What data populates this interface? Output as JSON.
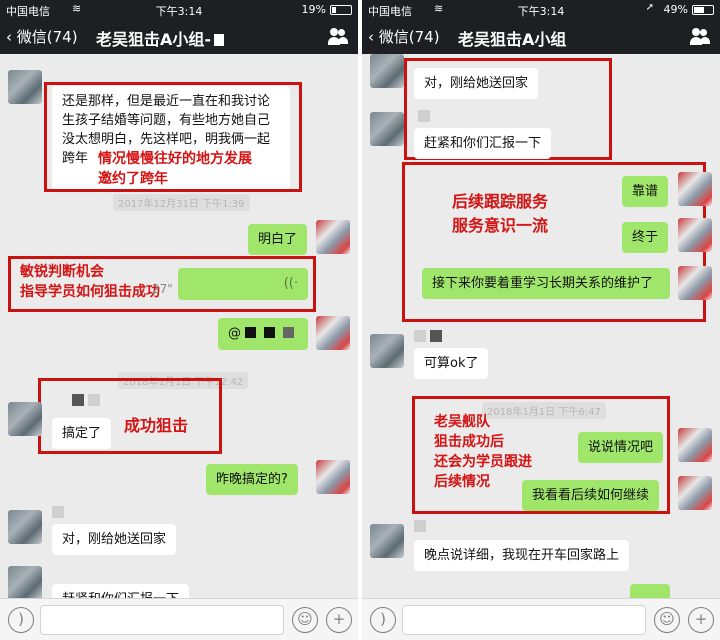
{
  "left": {
    "status": {
      "carrier": "中国电信",
      "time": "下午3:14",
      "battery": "19%",
      "battery_level": 0.19
    },
    "nav": {
      "back": "微信(74)",
      "title": "老吴狙击A小组-"
    },
    "messages": {
      "m1": "还是那样，但是最近一直在和我讨论生孩子结婚等问题，有些地方她自己没太想明白，先这样吧，明我俩一起跨年",
      "ts1": "2017年12月31日 下午1:39",
      "m2": "明白了",
      "voice_len": "27\"",
      "m3_prefix": "@",
      "ts2": "2018年1月1日 下午12:42",
      "m4": "搞定了",
      "m5": "昨晚搞定的?",
      "m6": "对，刚给她送回家",
      "m7": "赶紧和你们汇报一下"
    },
    "annotations": {
      "a1_line1": "情况慢慢往好的地方发展",
      "a1_line2": "邀约了跨年",
      "a2_line1": "敏锐判断机会",
      "a2_line2": "指导学员如何狙击成功",
      "a3": "成功狙击"
    }
  },
  "right": {
    "status": {
      "carrier": "中国电信",
      "time": "下午3:14",
      "battery": "49%",
      "battery_level": 0.49
    },
    "nav": {
      "back": "微信(74)",
      "title": "老吴狙击A小组"
    },
    "messages": {
      "m1": "对，刚给她送回家",
      "m2": "赶紧和你们汇报一下",
      "m3": "靠谱",
      "m4": "终于",
      "m5": "接下来你要着重学习长期关系的维护了",
      "m6": "可算ok了",
      "ts1": "2018年1月1日 下午6:47",
      "m7": "说说情况吧",
      "m8": "我看看后续如何继续",
      "m9": "晚点说详细，我现在开车回家路上"
    },
    "annotations": {
      "a1_line1": "后续跟踪服务",
      "a1_line2": "服务意识一流",
      "a2_line1": "老吴舰队",
      "a2_line2": "狙击成功后",
      "a2_line3": "还会为学员跟进",
      "a2_line4": "后续情况"
    }
  },
  "input": {
    "voice_icon": "voice-icon",
    "emoji_icon": "emoji-icon",
    "plus_icon": "plus-icon"
  },
  "colors": {
    "accent_red": "#cc1111",
    "bubble_green": "#9fe66b",
    "nav_bg": "#1e1f23"
  }
}
